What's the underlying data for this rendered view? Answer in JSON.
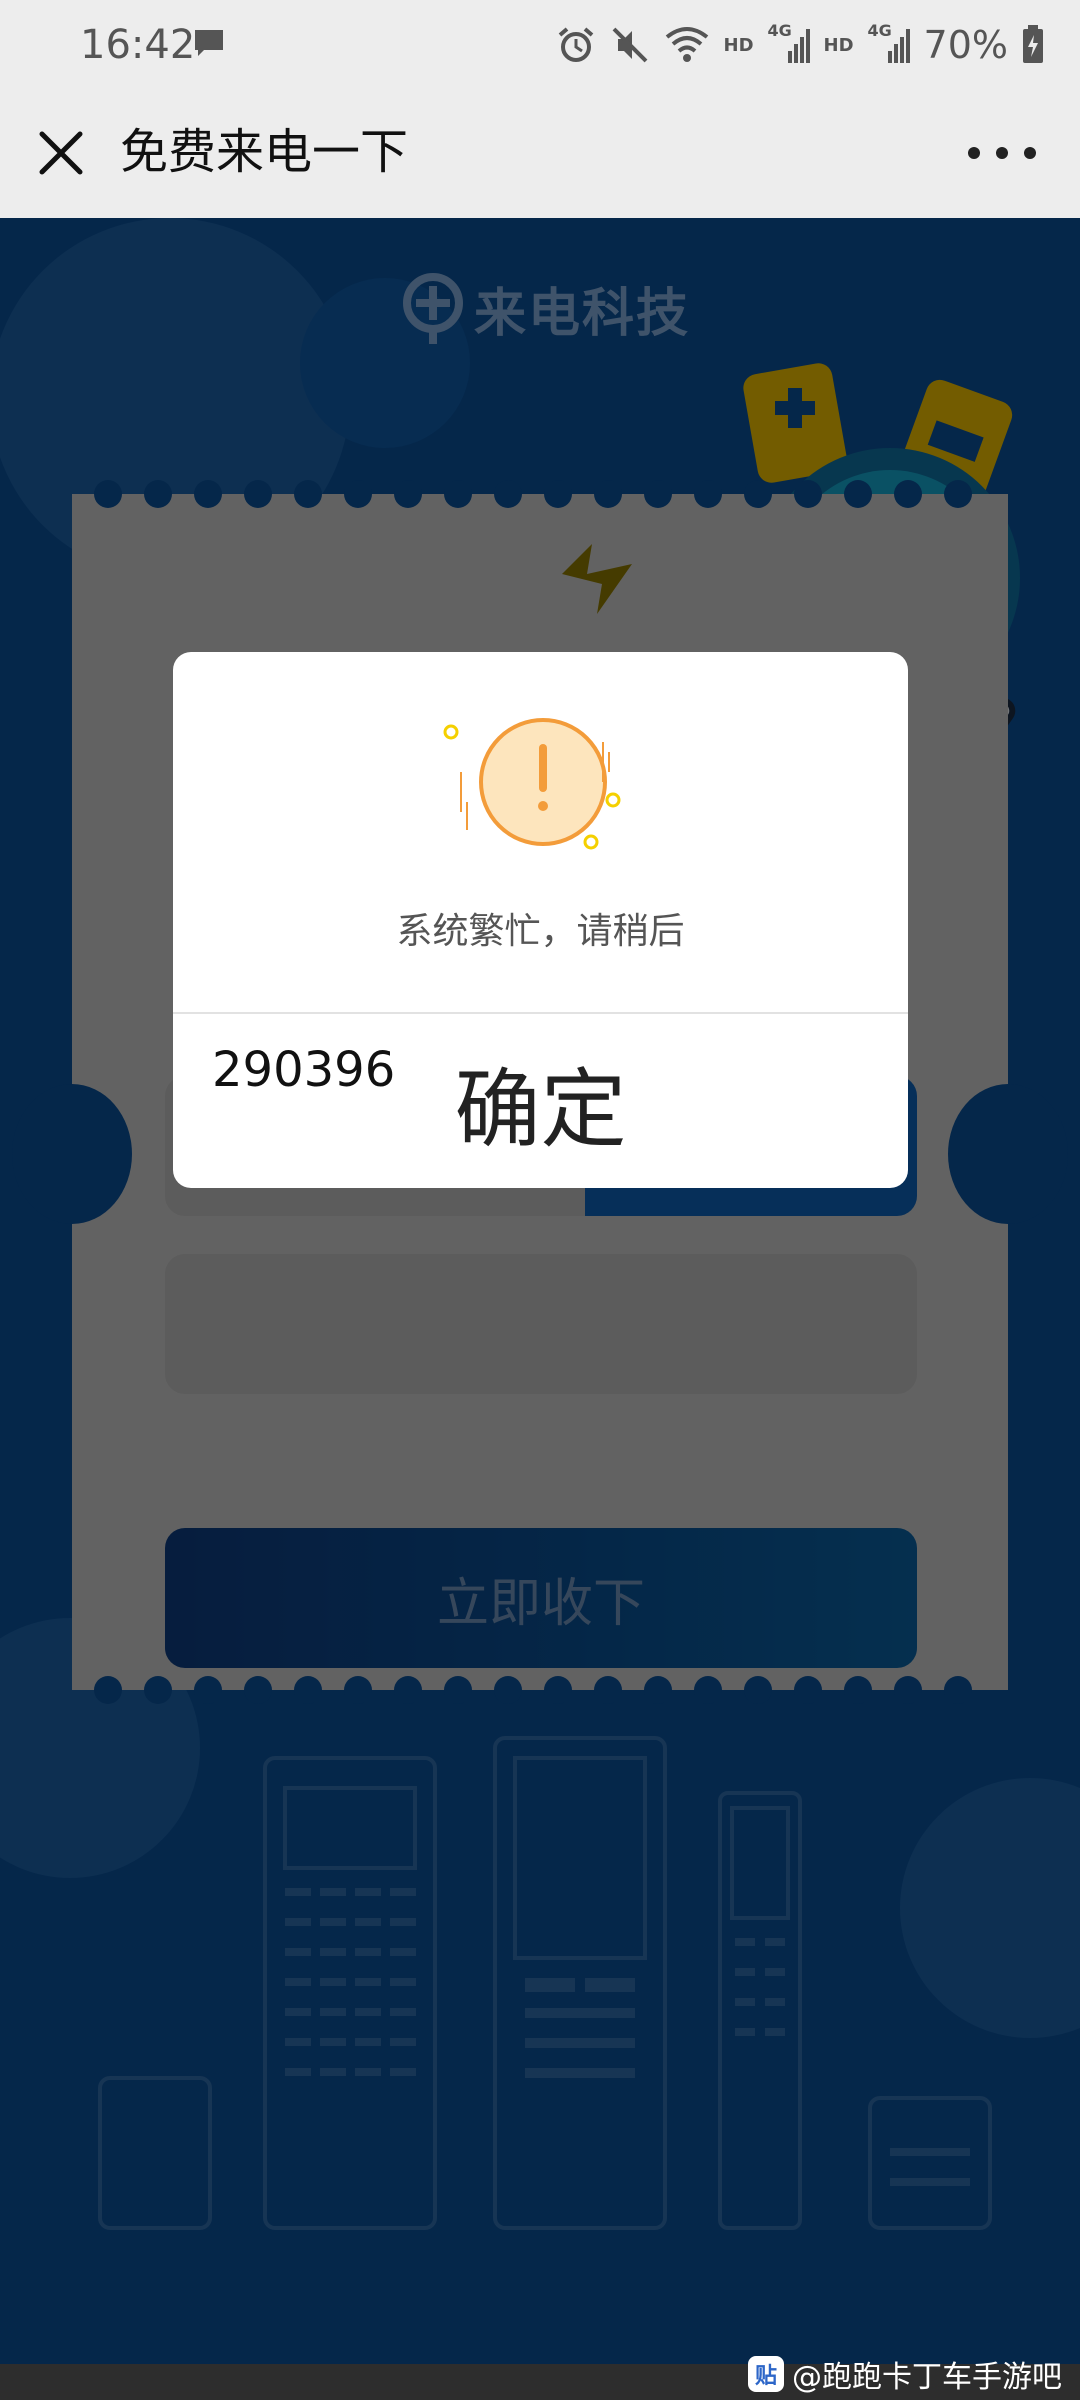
{
  "status_bar": {
    "time": "16:42",
    "battery_text": "70%",
    "net_label_1": "HD",
    "net_label_2": "HD",
    "net_gen_1": "4G",
    "net_gen_2": "4G",
    "icons": [
      "message-icon",
      "alarm-icon",
      "mute-icon",
      "wifi-icon",
      "signal-icon",
      "signal-icon",
      "battery-charging-icon"
    ]
  },
  "nav": {
    "title": "免费来电一下"
  },
  "page": {
    "logo_text": "来电科技",
    "code_value": "290396",
    "receive_button": "立即收下"
  },
  "dialog": {
    "message": "系统繁忙，请稍后",
    "confirm_label": "确定"
  },
  "watermark": {
    "badge": "贴",
    "text": "@跑跑卡丁车手游吧"
  },
  "colors": {
    "page_bg": "#0a4e95",
    "dialog_bg": "#ffffff",
    "warning_orange": "#f39c3a",
    "warning_fill": "#fde5bd"
  }
}
